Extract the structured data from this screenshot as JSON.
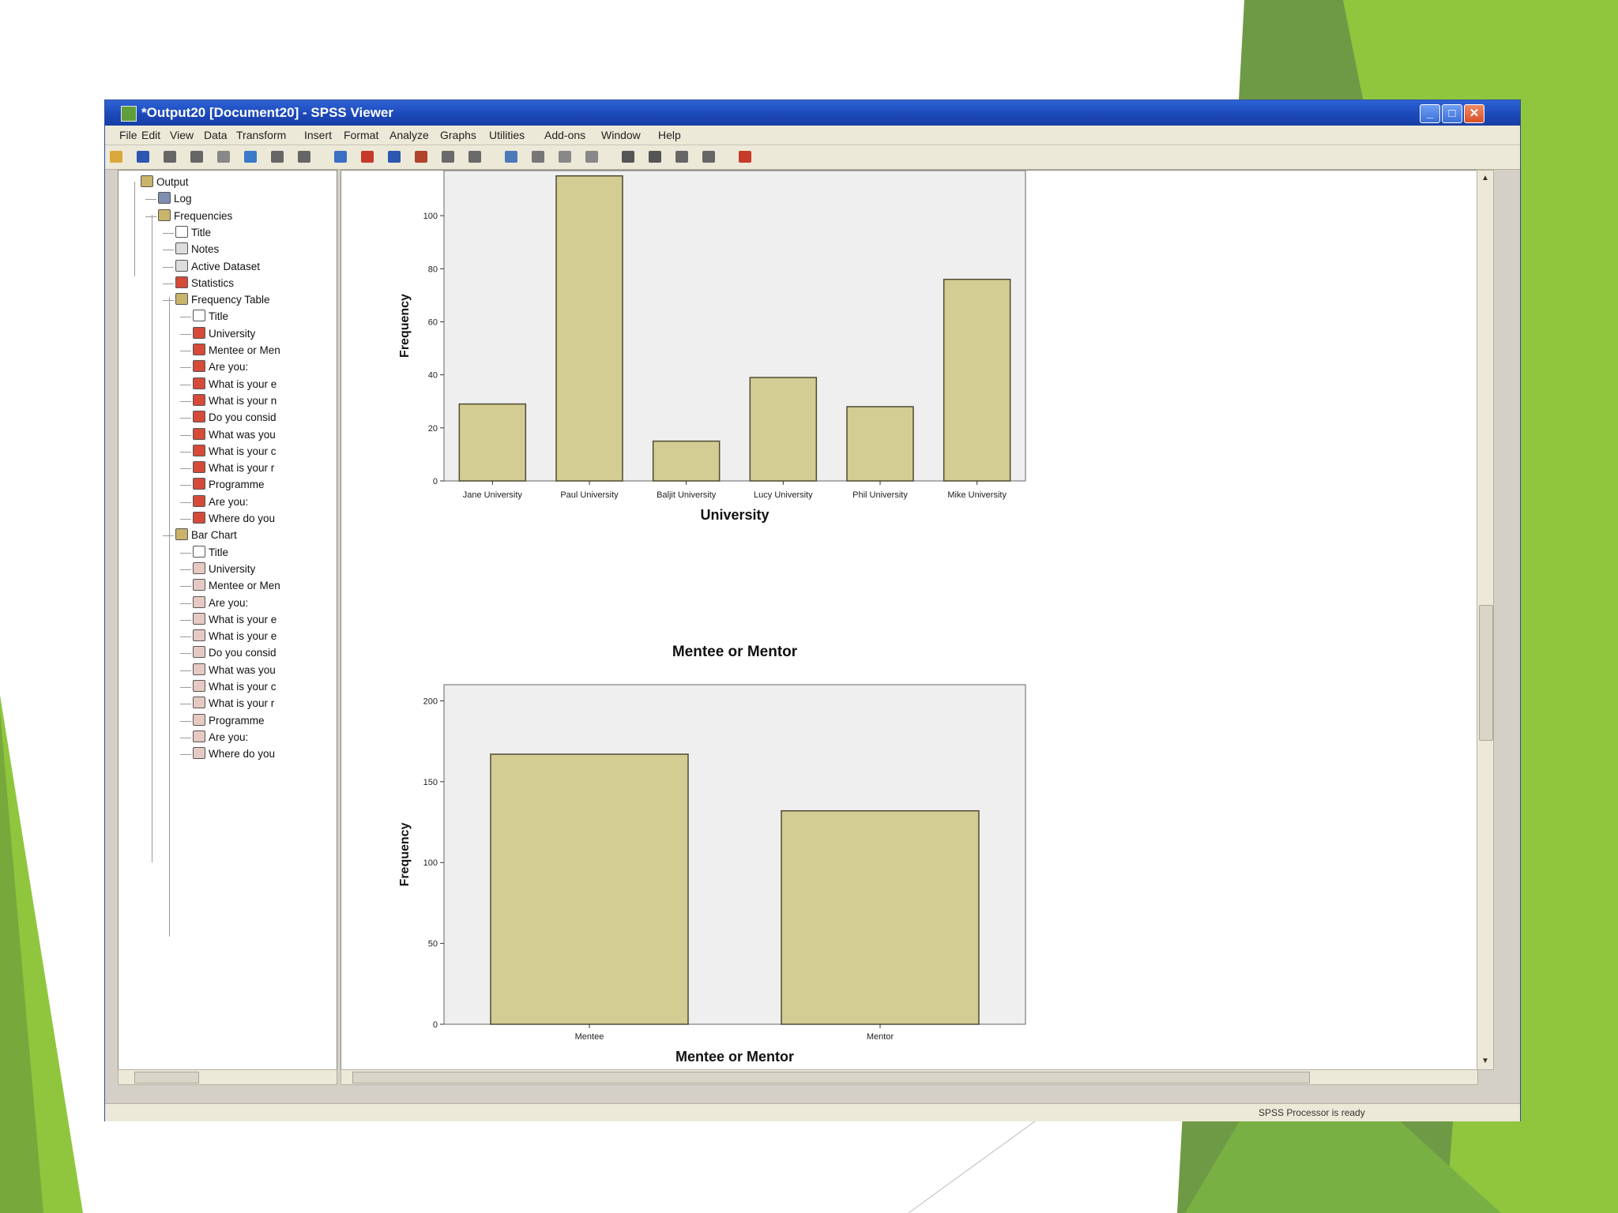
{
  "window": {
    "title": "*Output20 [Document20] - SPSS Viewer",
    "minimize_glyph": "_",
    "maximize_glyph": "□",
    "close_glyph": "✕"
  },
  "menu": [
    "File",
    "Edit",
    "View",
    "Data",
    "Transform",
    "Insert",
    "Format",
    "Analyze",
    "Graphs",
    "Utilities",
    "Add-ons",
    "Window",
    "Help"
  ],
  "toolbar": {
    "icons": [
      "open-icon",
      "save-icon",
      "print-icon",
      "print-preview-icon",
      "export-icon",
      "goto-data-icon",
      "undo-icon",
      "redo-icon",
      "goto-chart-icon",
      "variables-icon",
      "run-icon",
      "insert-heading-icon",
      "insert-title-icon",
      "insert-text-icon",
      "designate-window-icon",
      "select-last-output-icon",
      "promote-icon",
      "demote-icon",
      "expand-icon",
      "collapse-icon",
      "show-icon",
      "hide-icon",
      "help-icon"
    ]
  },
  "outline": {
    "items": [
      {
        "label": "Output",
        "icon": "folder-icon",
        "level": 0
      },
      {
        "label": "Log",
        "icon": "log-icon",
        "level": 1
      },
      {
        "label": "Frequencies",
        "icon": "folder-icon",
        "level": 1
      },
      {
        "label": "Title",
        "icon": "title-icon",
        "level": 2
      },
      {
        "label": "Notes",
        "icon": "notes-icon",
        "level": 2
      },
      {
        "label": "Active Dataset",
        "icon": "notes-icon",
        "level": 2
      },
      {
        "label": "Statistics",
        "icon": "table-icon",
        "level": 2
      },
      {
        "label": "Frequency Table",
        "icon": "folder-icon",
        "level": 2
      },
      {
        "label": "Title",
        "icon": "title-icon",
        "level": 3
      },
      {
        "label": "University",
        "icon": "table-icon",
        "level": 3
      },
      {
        "label": "Mentee or Men",
        "icon": "table-icon",
        "level": 3
      },
      {
        "label": "Are you:",
        "icon": "table-icon",
        "level": 3
      },
      {
        "label": "What is your e",
        "icon": "table-icon",
        "level": 3
      },
      {
        "label": "What is your n",
        "icon": "table-icon",
        "level": 3
      },
      {
        "label": "Do you consid",
        "icon": "table-icon",
        "level": 3
      },
      {
        "label": "What was you",
        "icon": "table-icon",
        "level": 3
      },
      {
        "label": "What is your c",
        "icon": "table-icon",
        "level": 3
      },
      {
        "label": "What is your r",
        "icon": "table-icon",
        "level": 3
      },
      {
        "label": "Programme",
        "icon": "table-icon",
        "level": 3
      },
      {
        "label": "Are you:",
        "icon": "table-icon",
        "level": 3
      },
      {
        "label": "Where do you",
        "icon": "table-icon",
        "level": 3
      },
      {
        "label": "Bar Chart",
        "icon": "folder-icon",
        "level": 2
      },
      {
        "label": "Title",
        "icon": "title-icon",
        "level": 3
      },
      {
        "label": "University",
        "icon": "chart-icon",
        "level": 3
      },
      {
        "label": "Mentee or Men",
        "icon": "chart-icon",
        "level": 3
      },
      {
        "label": "Are you:",
        "icon": "chart-icon",
        "level": 3
      },
      {
        "label": "What is your e",
        "icon": "chart-icon",
        "level": 3
      },
      {
        "label": "What is your e",
        "icon": "chart-icon",
        "level": 3
      },
      {
        "label": "Do you consid",
        "icon": "chart-icon",
        "level": 3
      },
      {
        "label": "What was you",
        "icon": "chart-icon",
        "level": 3
      },
      {
        "label": "What is your c",
        "icon": "chart-icon",
        "level": 3
      },
      {
        "label": "What is your r",
        "icon": "chart-icon",
        "level": 3
      },
      {
        "label": "Programme",
        "icon": "chart-icon",
        "level": 3
      },
      {
        "label": "Are you:",
        "icon": "chart-icon",
        "level": 3
      },
      {
        "label": "Where do you",
        "icon": "chart-icon",
        "level": 3
      }
    ]
  },
  "status": {
    "text": "SPSS Processor is ready"
  },
  "colors": {
    "bar_fill": "#d3cc93",
    "bar_stroke": "#4f4b32",
    "plot_bg": "#f0eff0",
    "green_dark": "#5e8f3a",
    "green_light": "#8fc63e"
  },
  "chart_data": [
    {
      "type": "bar",
      "title": "",
      "xlabel": "University",
      "ylabel": "Frequency",
      "categories": [
        "Jane University",
        "Paul University",
        "Baljit University",
        "Lucy University",
        "Phil University",
        "Mike University"
      ],
      "values": [
        29,
        115,
        15,
        39,
        28,
        76
      ],
      "yticks": [
        "0",
        "20",
        "40",
        "60",
        "80",
        "100"
      ],
      "ylim": [
        0,
        117
      ],
      "grid": false
    },
    {
      "type": "bar",
      "title": "Mentee or Mentor",
      "xlabel": "Mentee or Mentor",
      "ylabel": "Frequency",
      "categories": [
        "Mentee",
        "Mentor"
      ],
      "values": [
        167,
        132
      ],
      "yticks": [
        "0",
        "50",
        "100",
        "150",
        "200"
      ],
      "ylim": [
        0,
        210
      ],
      "grid": false
    }
  ]
}
